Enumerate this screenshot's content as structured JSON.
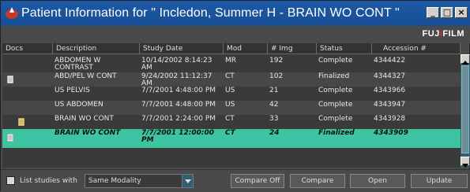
{
  "window": {
    "title": "Patient Information for \" Incledon, Summer H   - BRAIN WO CONT \"",
    "minimize": "_",
    "maximize": "□",
    "close": "×"
  },
  "brand": {
    "text_main": "FUJ",
    "text_accent": "i",
    "text_end": "FILM"
  },
  "columns": [
    "Docs",
    "Description",
    "Study Date",
    "Mod",
    "# Img",
    "Status",
    "Accession #"
  ],
  "rows": [
    {
      "doc": "",
      "description": "ABDOMEN W\nCONTRAST",
      "date": "10/14/2002 8:14:23\nAM",
      "mod": "MR",
      "img": "192",
      "status": "Complete",
      "accession": "4344422"
    },
    {
      "doc": "page",
      "description": "ABD/PEL W CONT",
      "date": "9/24/2002 11:12:37\nAM",
      "mod": "CT",
      "img": "102",
      "status": "Finalized",
      "accession": "4344327"
    },
    {
      "doc": "",
      "description": "US PELVIS",
      "date": "7/7/2001 4:48:00 PM",
      "mod": "US",
      "img": "21",
      "status": "Complete",
      "accession": "4343966"
    },
    {
      "doc": "",
      "description": "US ABDOMEN",
      "date": "7/7/2001 4:48:00 PM",
      "mod": "US",
      "img": "42",
      "status": "Complete",
      "accession": "4343947"
    },
    {
      "doc": "note",
      "description": "BRAIN WO CONT",
      "date": "7/7/2001 2:24:00 PM",
      "mod": "CT",
      "img": "33",
      "status": "Complete",
      "accession": "4343928"
    },
    {
      "doc": "page",
      "description": "BRAIN WO CONT",
      "date": "7/7/2001 12:00:00\nPM",
      "mod": "CT",
      "img": "24",
      "status": "Finalized",
      "accession": "4343909"
    }
  ],
  "bottom": {
    "list_label": "List studies with",
    "filter_value": "Same Modality",
    "compare_off": "Compare Off",
    "compare": "Compare",
    "open": "Open",
    "update": "Update"
  }
}
